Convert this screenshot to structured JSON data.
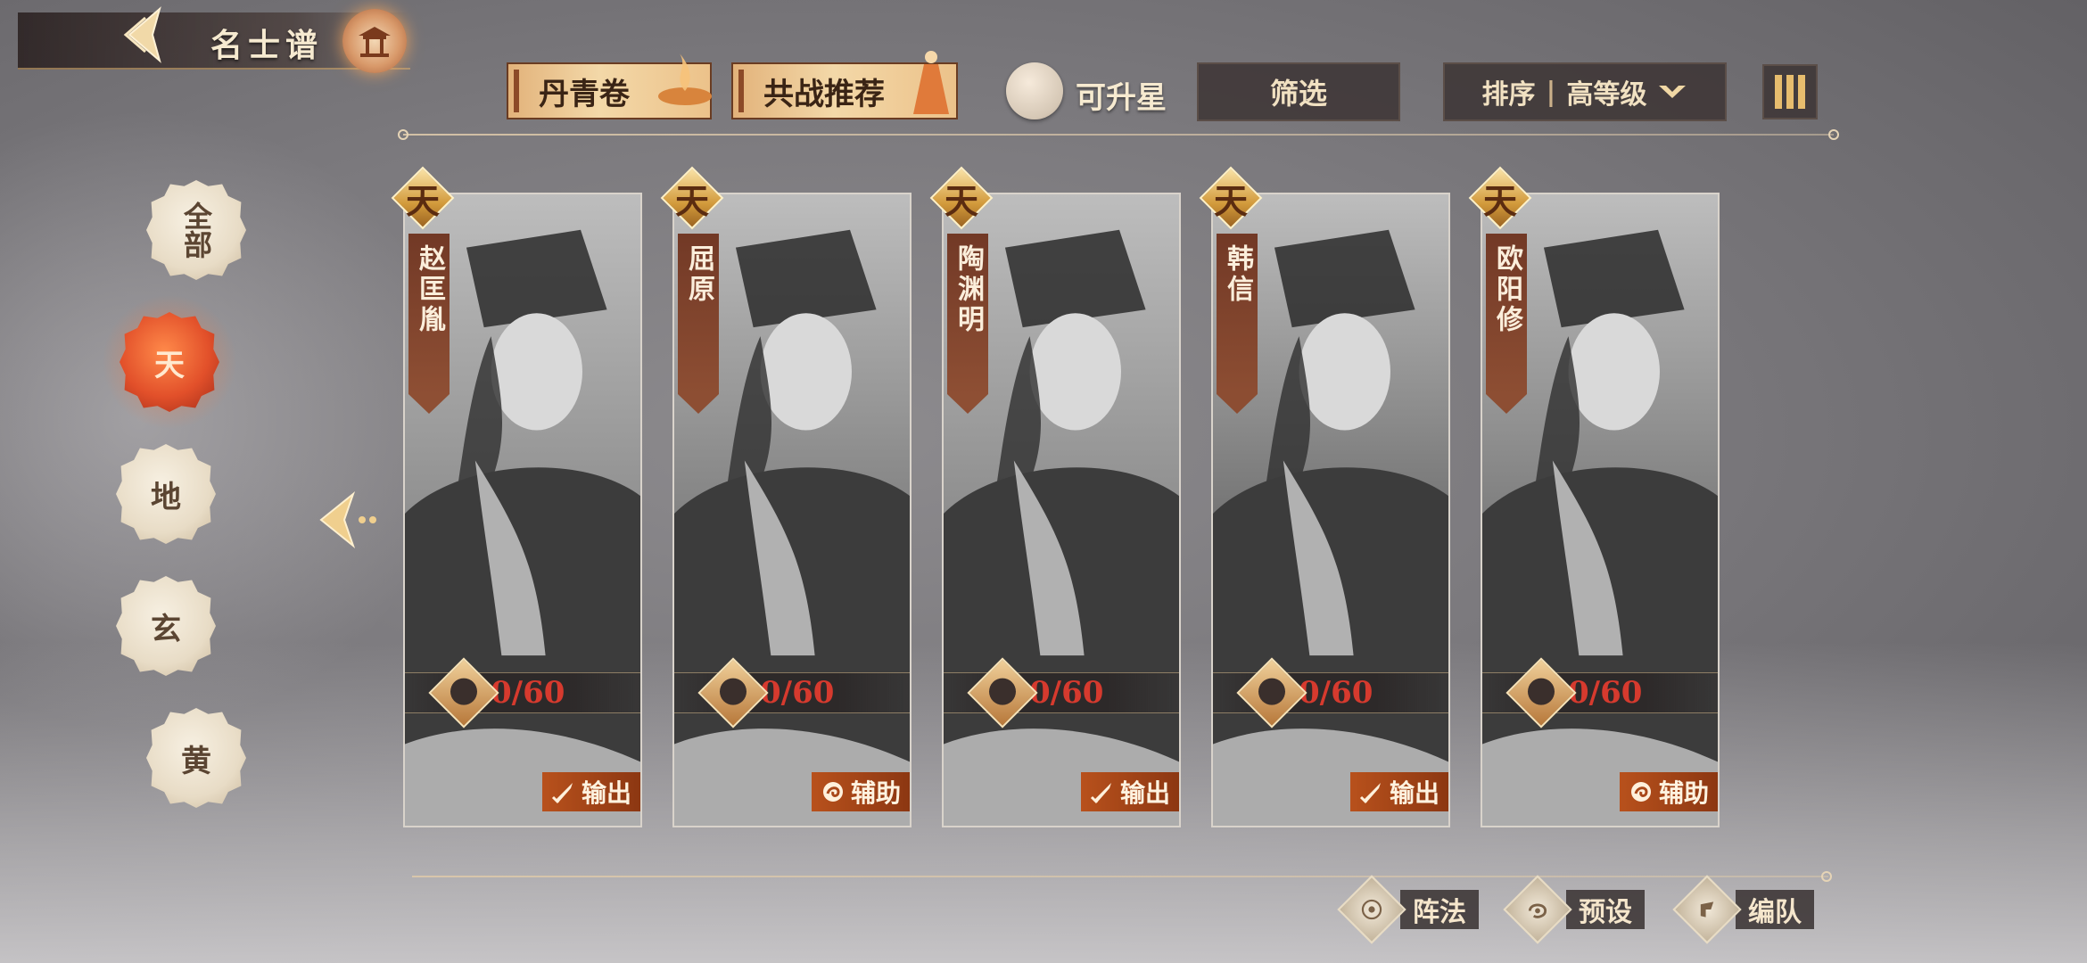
{
  "header": {
    "title": "名士谱"
  },
  "toolbar": {
    "tabs": [
      {
        "label": "丹青卷"
      },
      {
        "label": "共战推荐"
      }
    ],
    "upgrade_label": "可升星",
    "filter_label": "筛选",
    "sort_label": "排序",
    "sort_separator": "|",
    "sort_value": "高等级"
  },
  "rank_filter": {
    "items": [
      {
        "label": "全部",
        "selected": false
      },
      {
        "label": "天",
        "selected": true
      },
      {
        "label": "地",
        "selected": false
      },
      {
        "label": "玄",
        "selected": false
      },
      {
        "label": "黄",
        "selected": false
      }
    ]
  },
  "cards": [
    {
      "tier": "天",
      "name": "赵匡胤",
      "progress": "0/60",
      "role": "输出",
      "role_icon": "sword-icon"
    },
    {
      "tier": "天",
      "name": "屈原",
      "progress": "0/60",
      "role": "辅助",
      "role_icon": "support-icon"
    },
    {
      "tier": "天",
      "name": "陶渊明",
      "progress": "0/60",
      "role": "输出",
      "role_icon": "sword-icon"
    },
    {
      "tier": "天",
      "name": "韩信",
      "progress": "0/60",
      "role": "输出",
      "role_icon": "sword-icon"
    },
    {
      "tier": "天",
      "name": "欧阳修",
      "progress": "0/60",
      "role": "辅助",
      "role_icon": "support-icon"
    }
  ],
  "bottom_actions": [
    {
      "label": "阵法",
      "icon": "formation-icon"
    },
    {
      "label": "预设",
      "icon": "preset-icon"
    },
    {
      "label": "编队",
      "icon": "team-icon"
    }
  ],
  "colors": {
    "accent_gold": "#e2b27a",
    "progress_red": "#d63a2e",
    "selected_rank": "#e2502a",
    "role_tag": "#b8511c"
  }
}
